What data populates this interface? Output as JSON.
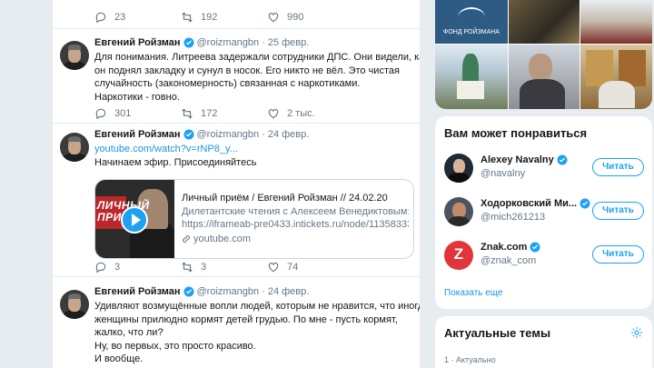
{
  "top_tweet": {
    "replies": "23",
    "retweets": "192",
    "likes": "990"
  },
  "tweets": [
    {
      "name": "Евгений Ройзман",
      "handle": "@roizmangbn",
      "date": "25 февр.",
      "lines": [
        "Для понимания. Литреева задержали сотрудники ДПС. Они видели, как",
        "он поднял закладку и сунул в носок. Его никто не вёл. Это чистая",
        "случайность (закономерность) связанная с наркотиками.",
        "Наркотики - говно."
      ],
      "replies": "301",
      "retweets": "172",
      "likes": "2 тыс."
    },
    {
      "name": "Евгений Ройзман",
      "handle": "@roizmangbn",
      "date": "24 февр.",
      "link": "youtube.com/watch?v=rNP8_y...",
      "lines": [
        "Начинаем эфир. Присоединяйтесь"
      ],
      "card": {
        "title": "Личный приём / Евгений Ройзман // 24.02.20",
        "desc1": "Дилетантские чтения с Алексеем Венедиктовым:",
        "desc2": "https://iframeab-pre0433.intickets.ru/node/11358333...",
        "domain": "youtube.com",
        "thumb_text": "ЛИЧНЫЙ ПРИЕМ"
      },
      "replies": "3",
      "retweets": "3",
      "likes": "74"
    },
    {
      "name": "Евгений Ройзман",
      "handle": "@roizmangbn",
      "date": "24 февр.",
      "lines": [
        "Удивляют возмущённые вопли людей, которым не нравится, что иногда",
        "женщины прилюдно кормят детей грудью. По мне - пусть кормят,",
        "жалко, что ли?",
        "Ну, во первых, это просто красиво.",
        "И вообще."
      ]
    }
  ],
  "photos": {
    "logo_text": "ФОНД РОЙЗМАНА"
  },
  "suggestions": {
    "title": "Вам может понравиться",
    "users": [
      {
        "name": "Alexey Navalny",
        "handle": "@navalny",
        "button": "Читать",
        "color": "#1f2a33"
      },
      {
        "name": "Ходорковский Ми...",
        "handle": "@mich261213",
        "button": "Читать",
        "color": "#c08b6a"
      },
      {
        "name": "Znak.com",
        "handle": "@znak_com",
        "button": "Читать",
        "color": "#e2343b",
        "letter": "Z"
      }
    ],
    "show_more": "Показать еще"
  },
  "trends": {
    "title": "Актуальные темы",
    "meta": "1 · Актуально"
  },
  "colors": {
    "accent": "#1da1f2",
    "link": "#1b95e0",
    "muted": "#657786",
    "bg": "#e6ecf0"
  }
}
